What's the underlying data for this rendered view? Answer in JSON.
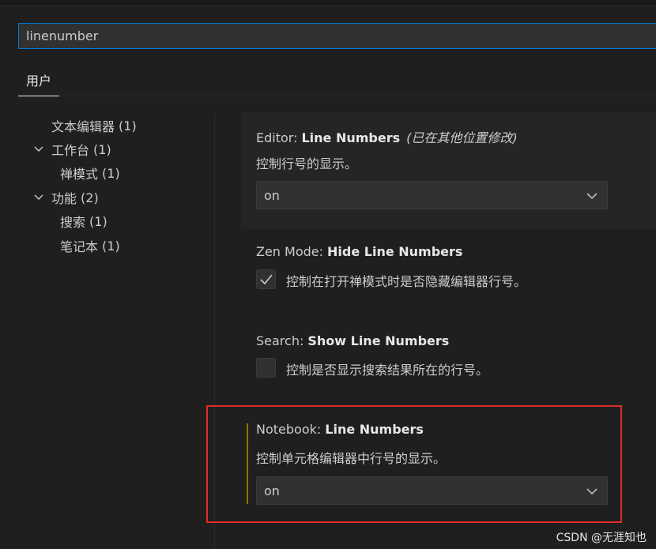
{
  "search": {
    "value": "linenumber"
  },
  "tabs": [
    {
      "label": "用户"
    }
  ],
  "toc": [
    {
      "label": "文本编辑器",
      "count": "(1)",
      "expandable": false
    },
    {
      "label": "工作台",
      "count": "(1)",
      "expandable": true
    },
    {
      "label": "禅模式",
      "count": "(1)",
      "expandable": false
    },
    {
      "label": "功能",
      "count": "(2)",
      "expandable": true
    },
    {
      "label": "搜索",
      "count": "(1)",
      "expandable": false
    },
    {
      "label": "笔记本",
      "count": "(1)",
      "expandable": false
    }
  ],
  "settings": {
    "editor": {
      "category": "Editor:",
      "name": "Line Numbers",
      "modified": "(已在其他位置修改)",
      "description": "控制行号的显示。",
      "value": "on"
    },
    "zen": {
      "category": "Zen Mode:",
      "name": "Hide Line Numbers",
      "description": "控制在打开禅模式时是否隐藏编辑器行号。",
      "checked": true
    },
    "search": {
      "category": "Search:",
      "name": "Show Line Numbers",
      "description": "控制是否显示搜索结果所在的行号。",
      "checked": false
    },
    "notebook": {
      "category": "Notebook:",
      "name": "Line Numbers",
      "description": "控制单元格编辑器中行号的显示。",
      "value": "on"
    }
  },
  "watermark": "CSDN @无涯知也",
  "colors": {
    "accent": "#0078d4",
    "modified": "#9e6a03",
    "highlight": "#e12b2b"
  }
}
